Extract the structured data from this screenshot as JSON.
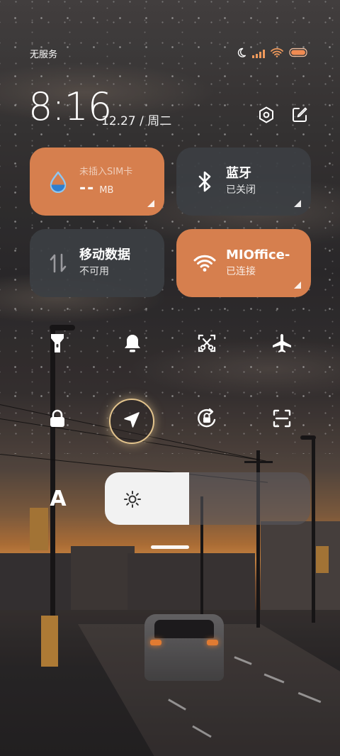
{
  "status_bar": {
    "carrier": "无服务",
    "battery_color": "#f08b52"
  },
  "header": {
    "time": "8:16",
    "date": "12.27 / 周二",
    "settings_icon": "hexagon-gear-icon",
    "edit_icon": "edit-icon"
  },
  "tiles": {
    "mobile_data_usage": {
      "label": "未插入SIM卡",
      "amount": "--",
      "unit": "MB",
      "icon": "water-drop-icon",
      "state": "on"
    },
    "bluetooth": {
      "label": "蓝牙",
      "sub": "已关闭",
      "icon": "bluetooth-icon",
      "state": "off"
    },
    "mobile_data": {
      "label": "移动数据",
      "sub": "不可用",
      "icon": "data-arrows-icon",
      "state": "off"
    },
    "wifi": {
      "label": "MIOffice-",
      "sub": "已连接",
      "icon": "wifi-icon",
      "state": "on"
    }
  },
  "toggles_row1": [
    {
      "name": "flashlight",
      "icon": "flashlight-icon"
    },
    {
      "name": "silent",
      "icon": "bell-icon"
    },
    {
      "name": "screenshot",
      "icon": "scissors-icon"
    },
    {
      "name": "airplane",
      "icon": "airplane-icon"
    }
  ],
  "toggles_row2": [
    {
      "name": "lock-screen",
      "icon": "lock-icon"
    },
    {
      "name": "location",
      "icon": "location-arrow-icon",
      "active": true
    },
    {
      "name": "rotation-lock",
      "icon": "rotation-lock-icon"
    },
    {
      "name": "scanner",
      "icon": "scan-icon"
    }
  ],
  "brightness": {
    "auto_label": "A",
    "level_fraction": 0.41
  },
  "colors": {
    "accent": "#d67f4e",
    "tile_off": "#3c3f43",
    "location_ring": "#e3c48d"
  }
}
